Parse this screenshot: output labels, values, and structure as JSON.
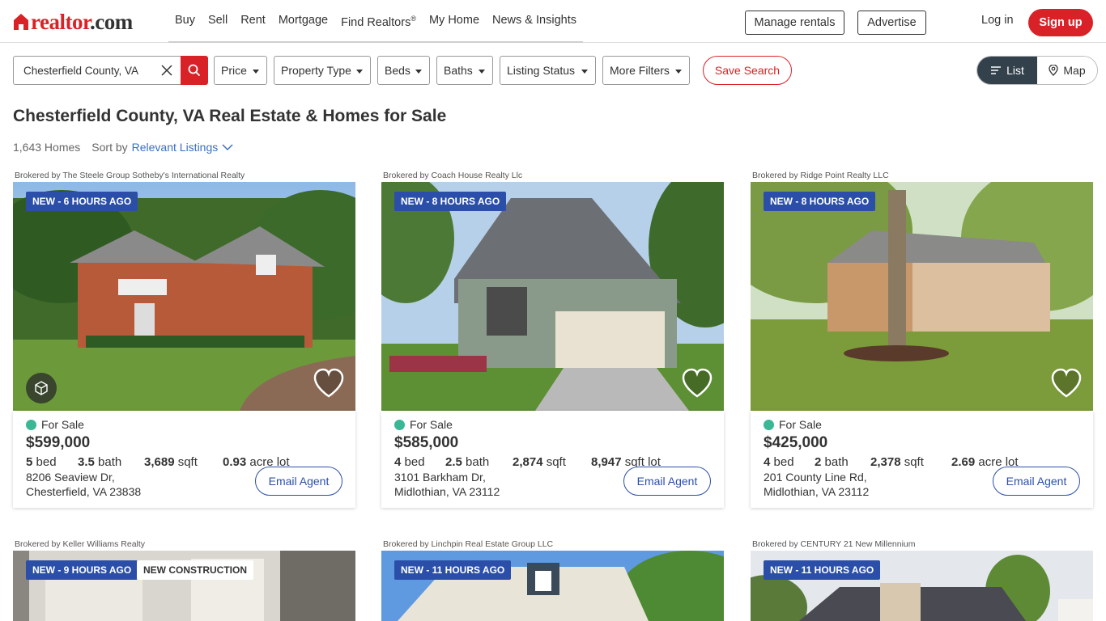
{
  "header": {
    "logo_text": "realtor",
    "logo_dot": ".com",
    "nav": [
      "Buy",
      "Sell",
      "Rent",
      "Mortgage",
      "Find Realtors",
      "My Home",
      "News & Insights"
    ],
    "find_realtors_mark": "®",
    "manage_rentals": "Manage rentals",
    "advertise": "Advertise",
    "login": "Log in",
    "signup": "Sign up"
  },
  "filters": {
    "search_value": "Chesterfield County, VA",
    "items": [
      "Price",
      "Property Type",
      "Beds",
      "Baths",
      "Listing Status",
      "More Filters"
    ],
    "save_search": "Save Search",
    "view_list": "List",
    "view_map": "Map"
  },
  "results": {
    "title": "Chesterfield County, VA Real Estate & Homes for Sale",
    "count": "1,643 Homes",
    "sort_label": "Sort by",
    "sort_value": "Relevant Listings"
  },
  "listings": [
    {
      "brokered": "Brokered by The Steele Group Sotheby's International Realty",
      "badge": "NEW - 6 HOURS AGO",
      "status": "For Sale",
      "price": "$599,000",
      "beds": "5",
      "beds_label": "bed",
      "baths": "3.5",
      "baths_label": "bath",
      "sqft": "3,689",
      "sqft_label": "sqft",
      "lot": "0.93",
      "lot_label": "acre lot",
      "address_line1": "8206 Seaview Dr,",
      "address_line2": "Chesterfield, VA 23838",
      "cta": "Email Agent"
    },
    {
      "brokered": "Brokered by Coach House Realty Llc",
      "badge": "NEW - 8 HOURS AGO",
      "status": "For Sale",
      "price": "$585,000",
      "beds": "4",
      "beds_label": "bed",
      "baths": "2.5",
      "baths_label": "bath",
      "sqft": "2,874",
      "sqft_label": "sqft",
      "lot": "8,947",
      "lot_label": "sqft lot",
      "address_line1": "3101 Barkham Dr,",
      "address_line2": "Midlothian, VA 23112",
      "cta": "Email Agent"
    },
    {
      "brokered": "Brokered by Ridge Point Realty LLC",
      "badge": "NEW - 8 HOURS AGO",
      "status": "For Sale",
      "price": "$425,000",
      "beds": "4",
      "beds_label": "bed",
      "baths": "2",
      "baths_label": "bath",
      "sqft": "2,378",
      "sqft_label": "sqft",
      "lot": "2.69",
      "lot_label": "acre lot",
      "address_line1": "201 County Line Rd,",
      "address_line2": "Midlothian, VA 23112",
      "cta": "Email Agent"
    },
    {
      "brokered": "Brokered by Keller Williams Realty",
      "badge": "NEW - 9 HOURS AGO",
      "badge2": "NEW CONSTRUCTION"
    },
    {
      "brokered": "Brokered by Linchpin Real Estate Group LLC",
      "badge": "NEW - 11 HOURS AGO"
    },
    {
      "brokered": "Brokered by CENTURY 21 New Millennium",
      "badge": "NEW - 11 HOURS AGO"
    }
  ],
  "icons": {
    "brand_color": "#d92228",
    "accent_blue": "#2b4fa8",
    "status_green": "#3ab795"
  }
}
